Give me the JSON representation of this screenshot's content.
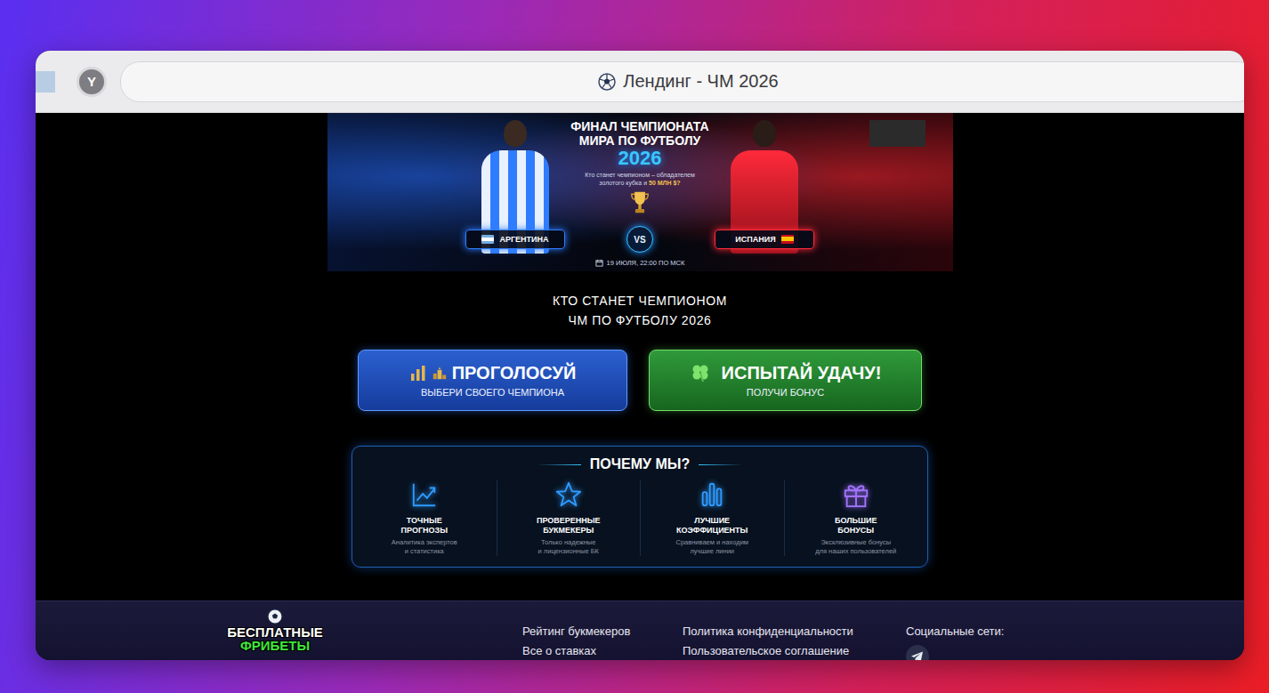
{
  "window": {
    "title": "Лендинг - ЧМ 2026"
  },
  "browser": {
    "profile_button": "Y"
  },
  "banner": {
    "title_lines": [
      "ФИНАЛ ЧЕМПИОНАТА",
      "МИРА ПО ФУТБОЛУ"
    ],
    "year": "2026",
    "subtitle": "Кто станет чемпионом – обладателем золотого кубка и",
    "prize": "50 МЛН $?",
    "teams": [
      {
        "name": "АРГЕНТИНА",
        "kind": "argentina",
        "color": "#2f7dff"
      },
      {
        "name": "ИСПАНИЯ",
        "kind": "spain",
        "color": "#ff2a3a"
      }
    ],
    "vs": "VS",
    "date": "19 ИЮЛЯ, 22:00 ПО МСК"
  },
  "heading": {
    "lines": [
      "КТО СТАНЕТ ЧЕМПИОНОМ",
      "ЧМ ПО ФУТБОЛУ 2026"
    ]
  },
  "actions": [
    {
      "title": "ПРОГОЛОСУЙ",
      "subtitle": "ВЫБЕРИ СВОЕГО ЧЕМПИОНА",
      "kind": "vote"
    },
    {
      "title": "ИСПЫТАЙ УДАЧУ!",
      "subtitle": "ПОЛУЧИ БОНУС",
      "kind": "luck"
    }
  ],
  "features": {
    "title": "ПОЧЕМУ МЫ?",
    "items": [
      {
        "title_lines": [
          "ТОЧНЫЕ",
          "ПРОГНОЗЫ"
        ],
        "text_lines": [
          "Аналитика экспертов",
          "и статистика"
        ],
        "kind": "chart",
        "color": "#2f9bff"
      },
      {
        "title_lines": [
          "ПРОВЕРЕННЫЕ",
          "БУКМЕКЕРЫ"
        ],
        "text_lines": [
          "Только надежные",
          "и лицензионные БК"
        ],
        "kind": "star",
        "color": "#2f9bff"
      },
      {
        "title_lines": [
          "ЛУЧШИЕ",
          "КОЭФФИЦИЕНТЫ"
        ],
        "text_lines": [
          "Сравниваем и находим",
          "лучшие линии"
        ],
        "kind": "bars",
        "color": "#2f9bff"
      },
      {
        "title_lines": [
          "БОЛЬШИЕ",
          "БОНУСЫ"
        ],
        "text_lines": [
          "Эксклюзивные бонусы",
          "для наших пользователей"
        ],
        "kind": "gift",
        "color": "#a374ff"
      }
    ]
  },
  "footer": {
    "logo_lines": [
      "БЕСПЛАТНЫЕ",
      "ФРИБЕТЫ"
    ],
    "link_columns": [
      [
        "Рейтинг букмекеров",
        "Все о ставках"
      ],
      [
        "Политика конфиденциальности",
        "Пользовательское соглашение"
      ]
    ],
    "social_title": "Социальные сети:"
  }
}
